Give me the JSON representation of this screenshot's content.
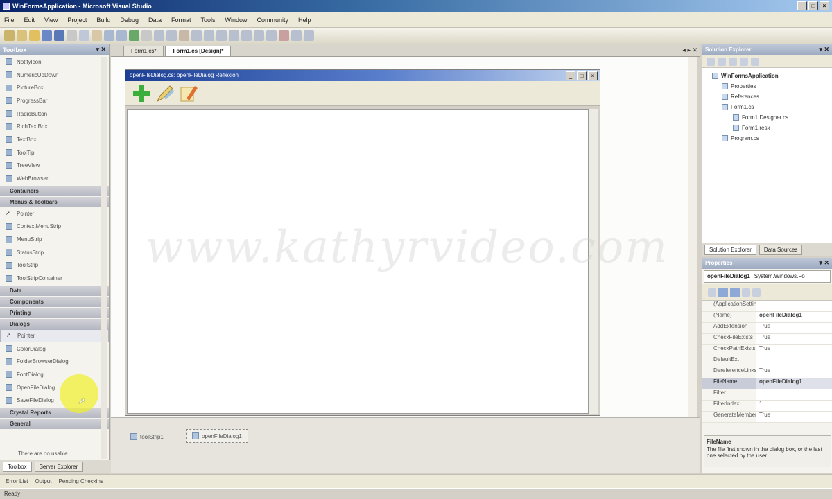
{
  "app": {
    "title": "WinFormsApplication - Microsoft Visual Studio"
  },
  "menu": [
    "File",
    "Edit",
    "View",
    "Project",
    "Build",
    "Debug",
    "Data",
    "Format",
    "Tools",
    "Window",
    "Community",
    "Help"
  ],
  "toolbox": {
    "title": "Toolbox",
    "items": [
      {
        "label": "NotifyIcon"
      },
      {
        "label": "NumericUpDown"
      },
      {
        "label": "PictureBox"
      },
      {
        "label": "ProgressBar"
      },
      {
        "label": "RadioButton"
      },
      {
        "label": "RichTextBox"
      },
      {
        "label": "TextBox"
      },
      {
        "label": "ToolTip"
      },
      {
        "label": "TreeView"
      },
      {
        "label": "WebBrowser"
      }
    ],
    "groups": {
      "containers": "Containers",
      "menus": "Menus & Toolbars",
      "data": "Data",
      "components": "Components",
      "printing": "Printing",
      "dialogs": "Dialogs",
      "crystal": "Crystal Reports",
      "general": "General"
    },
    "menu_items": [
      {
        "label": "Pointer"
      },
      {
        "label": "ContextMenuStrip"
      },
      {
        "label": "MenuStrip"
      },
      {
        "label": "StatusStrip"
      },
      {
        "label": "ToolStrip"
      },
      {
        "label": "ToolStripContainer"
      }
    ],
    "dialog_items": [
      {
        "label": "Pointer"
      },
      {
        "label": "ColorDialog"
      },
      {
        "label": "FolderBrowserDialog"
      },
      {
        "label": "FontDialog"
      },
      {
        "label": "OpenFileDialog"
      },
      {
        "label": "SaveFileDialog"
      }
    ],
    "empty_text": "There are no usable"
  },
  "doc_tabs": [
    "Form1.cs*",
    "Form1.cs [Design]*"
  ],
  "form": {
    "title": "openFileDialog.cs: openFileDialog Reflexion"
  },
  "watermark": "www.kathyrvideo.com",
  "tray": {
    "item1": "toolStrip1",
    "item2": "openFileDialog1"
  },
  "solution_explorer": {
    "title": "Solution Explorer",
    "items": [
      {
        "label": "WinFormsApplication",
        "bold": true,
        "indent": 0
      },
      {
        "label": "Properties",
        "indent": 1
      },
      {
        "label": "References",
        "indent": 1
      },
      {
        "label": "Form1.cs",
        "indent": 1
      },
      {
        "label": "Form1.Designer.cs",
        "indent": 2
      },
      {
        "label": "Form1.resx",
        "indent": 2
      },
      {
        "label": "Program.cs",
        "indent": 1
      }
    ],
    "tab_solution": "Solution Explorer",
    "tab_data": "Data Sources"
  },
  "properties": {
    "title": "Properties",
    "object_name": "openFileDialog1",
    "object_type": "System.Windows.Fo",
    "rows": [
      {
        "name": "(ApplicationSettings)",
        "value": ""
      },
      {
        "name": "(Name)",
        "value": "openFileDialog1",
        "bold": true
      },
      {
        "name": "AddExtension",
        "value": "True"
      },
      {
        "name": "CheckFileExists",
        "value": "True"
      },
      {
        "name": "CheckPathExists",
        "value": "True"
      },
      {
        "name": "DefaultExt",
        "value": ""
      },
      {
        "name": "DereferenceLinks",
        "value": "True"
      },
      {
        "name": "FileName",
        "value": "openFileDialog1",
        "selected": true
      },
      {
        "name": "Filter",
        "value": ""
      },
      {
        "name": "FilterIndex",
        "value": "1"
      },
      {
        "name": "GenerateMember",
        "value": "True"
      }
    ],
    "desc_title": "FileName",
    "desc_text": "The file first shown in the dialog box, or the last one selected by the user."
  },
  "bottom": {
    "tab_toolbox": "Toolbox",
    "tab_server": "Server Explorer",
    "output_tabs": [
      "Error List",
      "Output",
      "Pending Checkins"
    ],
    "status": "Ready"
  }
}
